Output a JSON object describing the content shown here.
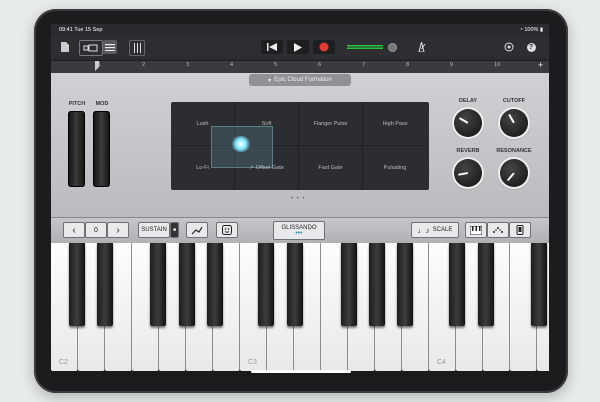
{
  "status": {
    "time_date": "09:41  Tue 15 Sep",
    "battery": "100%"
  },
  "toolbar": {
    "browser_icon": "document-icon",
    "view_icon": "tracks-view-icon",
    "editor_icon": "editor-icon",
    "mixer_icon": "mixer-icon",
    "go_start_icon": "go-to-beginning-icon",
    "play_icon": "play-icon",
    "record_icon": "record-icon",
    "metronome_icon": "metronome-icon",
    "settings_icon": "settings-icon",
    "help_label": "?",
    "record_color": "#e23a33",
    "level_color": "#27c33b"
  },
  "ruler": {
    "numbers": [
      "1",
      "2",
      "3",
      "4",
      "5",
      "6",
      "7",
      "8",
      "9",
      "10"
    ],
    "add_label": "+"
  },
  "instrument": {
    "title": "Epic Cloud Formation",
    "pitch_label": "PITCH",
    "mod_label": "MOD",
    "pads": [
      "Lush",
      "Soft",
      "Flanger Pulse",
      "High Pass",
      "Lo-Fi",
      "Offset Gate",
      "Fast Gate",
      "Pulsating"
    ],
    "pad_indicator": "↗",
    "page_dots": "• • •",
    "knobs": [
      {
        "label": "DELAY"
      },
      {
        "label": "CUTOFF"
      },
      {
        "label": "REVERB"
      },
      {
        "label": "RESONANCE"
      }
    ]
  },
  "controls": {
    "octave_down": "‹",
    "octave_value": "0",
    "octave_up": "›",
    "sustain_label": "SUSTAIN",
    "glissando_label": "GLISSANDO",
    "glissando_dots": "•••",
    "scale_label": "SCALE",
    "scale_icon": "♩♪"
  },
  "keyboard": {
    "octave_labels": [
      "C2",
      "C3",
      "C4"
    ]
  }
}
